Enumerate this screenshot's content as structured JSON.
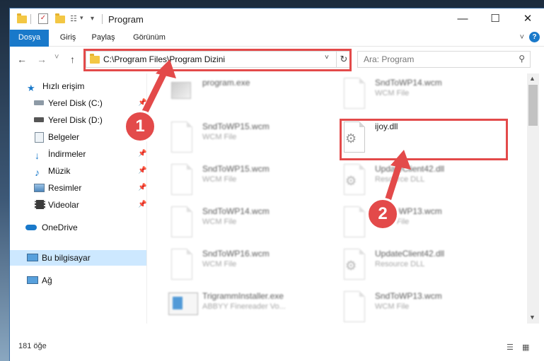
{
  "window": {
    "title": "Program",
    "minimize": "—",
    "maximize": "☐",
    "close": "✕"
  },
  "ribbon": {
    "tabs": [
      "Dosya",
      "Giriş",
      "Paylaş",
      "Görünüm"
    ],
    "help": "?"
  },
  "nav": {
    "back": "←",
    "forward": "→",
    "recent": "˅",
    "up": "↑",
    "address": "C:\\Program Files\\Program Dizini",
    "address_dropdown": "˅",
    "refresh": "↻",
    "search_placeholder": "Ara: Program",
    "search_icon": "⚲"
  },
  "sidebar": {
    "items": [
      {
        "label": "Hızlı erişim",
        "icon": "star-icon",
        "pinned": false
      },
      {
        "label": "Yerel Disk (C:)",
        "icon": "drive-icon",
        "pinned": true
      },
      {
        "label": "Yerel Disk (D:)",
        "icon": "drive-icon",
        "pinned": true
      },
      {
        "label": "Belgeler",
        "icon": "documents-icon",
        "pinned": true
      },
      {
        "label": "İndirmeler",
        "icon": "download-icon",
        "pinned": true
      },
      {
        "label": "Müzik",
        "icon": "music-icon",
        "pinned": true
      },
      {
        "label": "Resimler",
        "icon": "pictures-icon",
        "pinned": true
      },
      {
        "label": "Videolar",
        "icon": "video-icon",
        "pinned": true
      },
      {
        "label": "OneDrive",
        "icon": "cloud-icon",
        "pinned": false
      },
      {
        "label": "Bu bilgisayar",
        "icon": "computer-icon",
        "pinned": false
      },
      {
        "label": "Ağ",
        "icon": "network-icon",
        "pinned": false
      }
    ],
    "pin_glyph": "📌"
  },
  "files": [
    {
      "name": "program.exe",
      "type": "",
      "icon": "exe-icon",
      "blurred": true
    },
    {
      "name": "SndToWP14.wcm",
      "type": "WCM File",
      "icon": "file-icon",
      "blurred": true
    },
    {
      "name": "SndToWP15.wcm",
      "type": "WCM File",
      "icon": "file-icon",
      "blurred": true
    },
    {
      "name": "ijoy.dll",
      "type": "",
      "icon": "dll-gear-icon",
      "blurred": false
    },
    {
      "name": "SndToWP15.wcm",
      "type": "WCM File",
      "icon": "file-icon",
      "blurred": true
    },
    {
      "name": "UpdateClient42.dll",
      "type": "Resource DLL",
      "icon": "dll-gear-icon",
      "blurred": true
    },
    {
      "name": "SndToWP14.wcm",
      "type": "WCM File",
      "icon": "file-icon",
      "blurred": true
    },
    {
      "name": "SndToWP13.wcm",
      "type": "WCM File",
      "icon": "file-icon",
      "blurred": true
    },
    {
      "name": "SndToWP16.wcm",
      "type": "WCM File",
      "icon": "file-icon",
      "blurred": true
    },
    {
      "name": "UpdateClient42.dll",
      "type": "Resource DLL",
      "icon": "dll-gear-icon",
      "blurred": true
    },
    {
      "name": "TrigrammInstaller.exe",
      "type": "ABBYY Finereader Vo...",
      "icon": "installer-icon",
      "blurred": true
    },
    {
      "name": "SndToWP13.wcm",
      "type": "WCM File",
      "icon": "file-icon",
      "blurred": true
    }
  ],
  "status": {
    "count": "181 öğe"
  },
  "callouts": {
    "one": "1",
    "two": "2"
  },
  "colors": {
    "accent": "#1979ca",
    "highlight": "#e34a4a",
    "selected": "#cde8ff"
  }
}
